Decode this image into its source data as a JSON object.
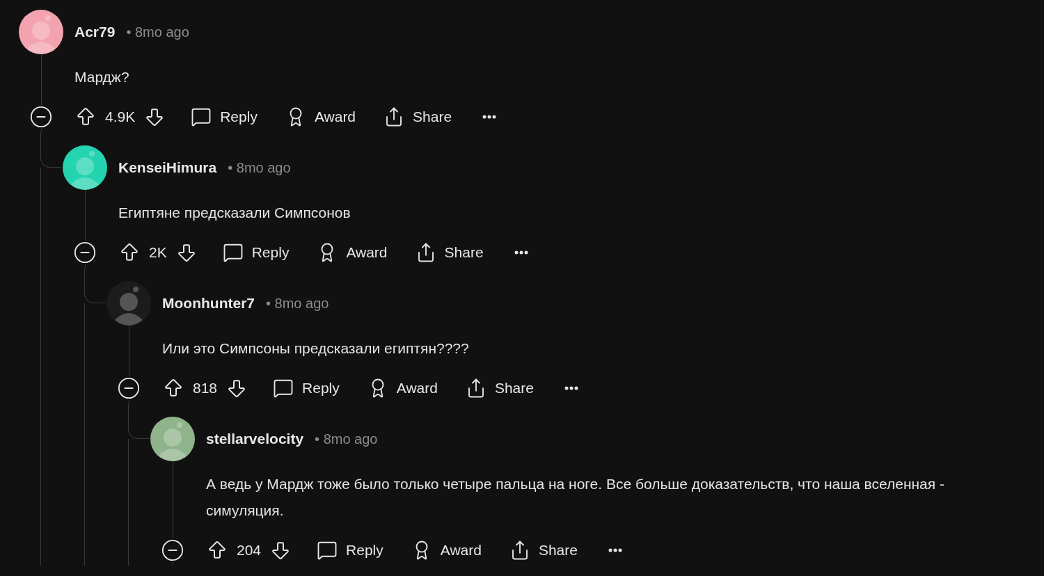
{
  "comments": [
    {
      "username": "Acr79",
      "time": "• 8mo ago",
      "text": "Мардж?",
      "score": "4.9K",
      "expanded": true,
      "actions": [
        {
          "kind": "reply",
          "label": "Reply"
        },
        {
          "kind": "award",
          "label": "Award"
        },
        {
          "kind": "share",
          "label": "Share"
        },
        {
          "kind": "more"
        }
      ],
      "children": [
        {
          "username": "KenseiHimura",
          "time": "• 8mo ago",
          "text": "Египтяне предсказали Симпсонов",
          "score": "2K",
          "expanded": true,
          "actions": [
            {
              "kind": "reply",
              "label": "Reply"
            },
            {
              "kind": "award",
              "label": "Award"
            },
            {
              "kind": "share",
              "label": "Share"
            },
            {
              "kind": "more"
            }
          ],
          "children": [
            {
              "username": "Moonhunter7",
              "time": "• 8mo ago",
              "text": "Или это Симпсоны предсказали египтян????",
              "score": "818",
              "expanded": true,
              "actions": [
                {
                  "kind": "reply",
                  "label": "Reply"
                },
                {
                  "kind": "award",
                  "label": "Award"
                },
                {
                  "kind": "share",
                  "label": "Share"
                },
                {
                  "kind": "more"
                }
              ],
              "children": [
                {
                  "username": "stellarvelocity",
                  "time": "• 8mo ago",
                  "text": "А ведь у Мардж тоже было только четыре пальца на ноге. Все больше доказательств, что наша вселенная - симуляция.",
                  "score": "204",
                  "expanded": true,
                  "actions": [
                    {
                      "kind": "reply",
                      "label": "Reply"
                    },
                    {
                      "kind": "award",
                      "label": "Award"
                    },
                    {
                      "kind": "share",
                      "label": "Share"
                    },
                    {
                      "kind": "more"
                    }
                  ]
                }
              ]
            }
          ]
        }
      ]
    }
  ]
}
